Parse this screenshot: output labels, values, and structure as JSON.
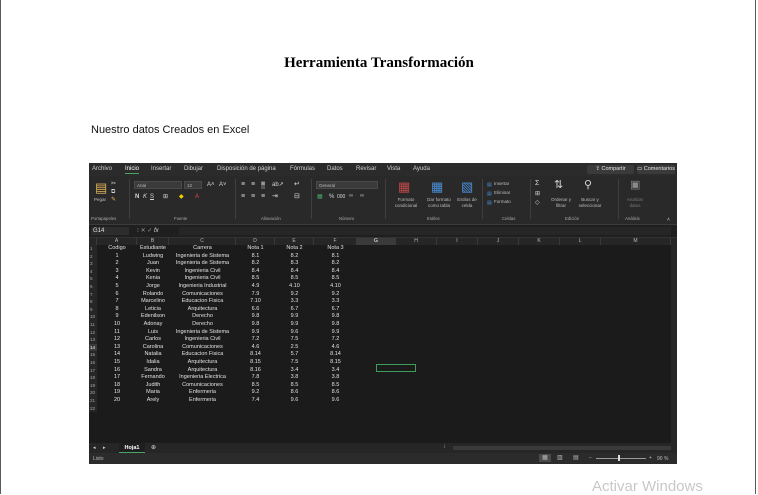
{
  "document": {
    "title": "Herramienta Transformación",
    "caption": "Nuestro datos Creados en Excel",
    "watermark": "Activar Windows"
  },
  "excel": {
    "menu": [
      "Archivo",
      "Inicio",
      "Insertar",
      "Dibujar",
      "Disposición de página",
      "Fórmulas",
      "Datos",
      "Revisar",
      "Vista",
      "Ayuda"
    ],
    "active_menu": "Inicio",
    "share_label": "Compartir",
    "comments_label": "Comentarios",
    "ribbon": {
      "paste_label": "Pegar",
      "font_name": "Arial",
      "font_size": "12",
      "number_format": "General",
      "conditional_format": "Formato condicional",
      "format_as_table": "Dar formato como tabla",
      "cell_styles": "Estilos de celda",
      "insert": "Insertar",
      "delete": "Eliminar",
      "format": "Formato",
      "sort_filter": "Ordenar y filtrar",
      "find_select": "Buscar y seleccionar",
      "analyze": "Analizar datos",
      "groups": [
        "Portapapeles",
        "Fuente",
        "Alineación",
        "Número",
        "Estilos",
        "Celdas",
        "Edición",
        "Análisis"
      ]
    },
    "name_box": "G14",
    "fx_label": "fx",
    "columns": [
      "A",
      "B",
      "C",
      "D",
      "E",
      "F",
      "G",
      "H",
      "I",
      "J",
      "K",
      "L",
      "M"
    ],
    "headers": [
      "Codigo",
      "Estudiante",
      "Carrera",
      "Nota 1",
      "Nota 2",
      "Nota 3"
    ],
    "rows": [
      [
        "1",
        "Ludwing",
        "Ingenieria de Sistema",
        "8.1",
        "8.2",
        "8.1"
      ],
      [
        "2",
        "Juan",
        "Ingenieria de Sistema",
        "8.2",
        "8.3",
        "8.2"
      ],
      [
        "3",
        "Kevin",
        "Ingenieria Civil",
        "8.4",
        "8.4",
        "8.4"
      ],
      [
        "4",
        "Kenia",
        "Ingenieria Civil",
        "8.5",
        "8.5",
        "8.5"
      ],
      [
        "5",
        "Jorge",
        "Ingenieria Industrial",
        "4.9",
        "4.10",
        "4.10"
      ],
      [
        "6",
        "Rolando",
        "Comunicaciones",
        "7.9",
        "9.2",
        "9.2"
      ],
      [
        "7",
        "Marcelino",
        "Educacion Fisica",
        "7.10",
        "3.3",
        "3.3"
      ],
      [
        "8",
        "Leticia",
        "Arquitectura",
        "6.6",
        "6.7",
        "6.7"
      ],
      [
        "9",
        "Edenilson",
        "Derecho",
        "9.8",
        "9.9",
        "9.8"
      ],
      [
        "10",
        "Adonay",
        "Derecho",
        "9.8",
        "9.9",
        "9.8"
      ],
      [
        "11",
        "Luis",
        "Ingenieria de Sistema",
        "9.9",
        "9.6",
        "9.9"
      ],
      [
        "12",
        "Carlos",
        "Ingenieria Civil",
        "7.2",
        "7.5",
        "7.2"
      ],
      [
        "13",
        "Carolina",
        "Comunicaciones",
        "4.6",
        "2.5",
        "4.6"
      ],
      [
        "14",
        "Natalia",
        "Educacion Fisica",
        "8.14",
        "5.7",
        "8.14"
      ],
      [
        "15",
        "Idalia",
        "Arquitectura",
        "8.15",
        "7.5",
        "8.15"
      ],
      [
        "16",
        "Sandra",
        "Arquitectura",
        "8.16",
        "3.4",
        "3.4"
      ],
      [
        "17",
        "Fernando",
        "Ingenieria Electrica",
        "7.8",
        "3.8",
        "3.8"
      ],
      [
        "18",
        "Judith",
        "Comunicaciones",
        "8.5",
        "8.5",
        "8.5"
      ],
      [
        "19",
        "Maria",
        "Enfermeria",
        "9.2",
        "8.6",
        "8.6"
      ],
      [
        "20",
        "Arely",
        "Enfermeria",
        "7.4",
        "9.6",
        "9.6"
      ]
    ],
    "row_numbers": [
      "1",
      "2",
      "3",
      "4",
      "5",
      "6",
      "7",
      "8",
      "9",
      "10",
      "11",
      "12",
      "13",
      "14",
      "15",
      "16",
      "17",
      "18",
      "19",
      "20",
      "21",
      "22"
    ],
    "sheet_tab": "Hoja1",
    "status_ready": "Listo",
    "zoom": "90 %"
  }
}
